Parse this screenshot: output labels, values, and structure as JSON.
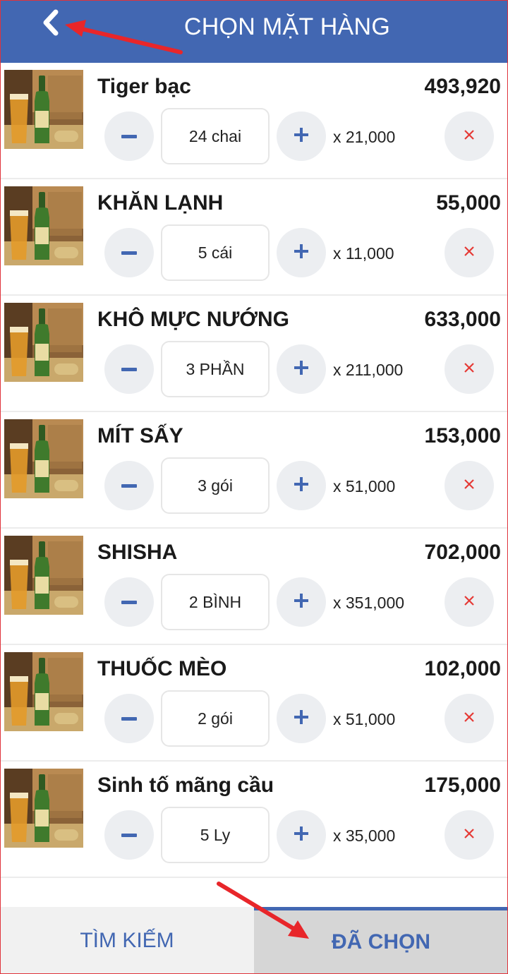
{
  "header": {
    "title": "CHỌN MẶT HÀNG"
  },
  "items": [
    {
      "name": "Tiger bạc",
      "total": "493,920",
      "qty": "24 chai",
      "unit_price": "x 21,000"
    },
    {
      "name": "KHĂN LẠNH",
      "total": "55,000",
      "qty": "5 cái",
      "unit_price": "x 11,000"
    },
    {
      "name": "KHÔ MỰC NƯỚNG",
      "total": "633,000",
      "qty": "3 PHẦN",
      "unit_price": "x 211,000"
    },
    {
      "name": "MÍT SẤY",
      "total": "153,000",
      "qty": "3 gói",
      "unit_price": "x 51,000"
    },
    {
      "name": "SHISHA",
      "total": "702,000",
      "qty": "2 BÌNH",
      "unit_price": "x 351,000"
    },
    {
      "name": "THUỐC MÈO",
      "total": "102,000",
      "qty": "2 gói",
      "unit_price": "x 51,000"
    },
    {
      "name": "Sinh tố mãng cầu",
      "total": "175,000",
      "qty": "5 Ly",
      "unit_price": "x 35,000"
    }
  ],
  "tabs": {
    "search": "TÌM KIẾM",
    "selected": "ĐÃ CHỌN"
  },
  "icons": {
    "back": "chevron-left-icon",
    "minus": "minus-icon",
    "plus": "plus-icon",
    "remove": "close-icon"
  },
  "colors": {
    "accent": "#4267b2",
    "remove": "#e53935",
    "annotation_arrow": "#e8262a"
  }
}
